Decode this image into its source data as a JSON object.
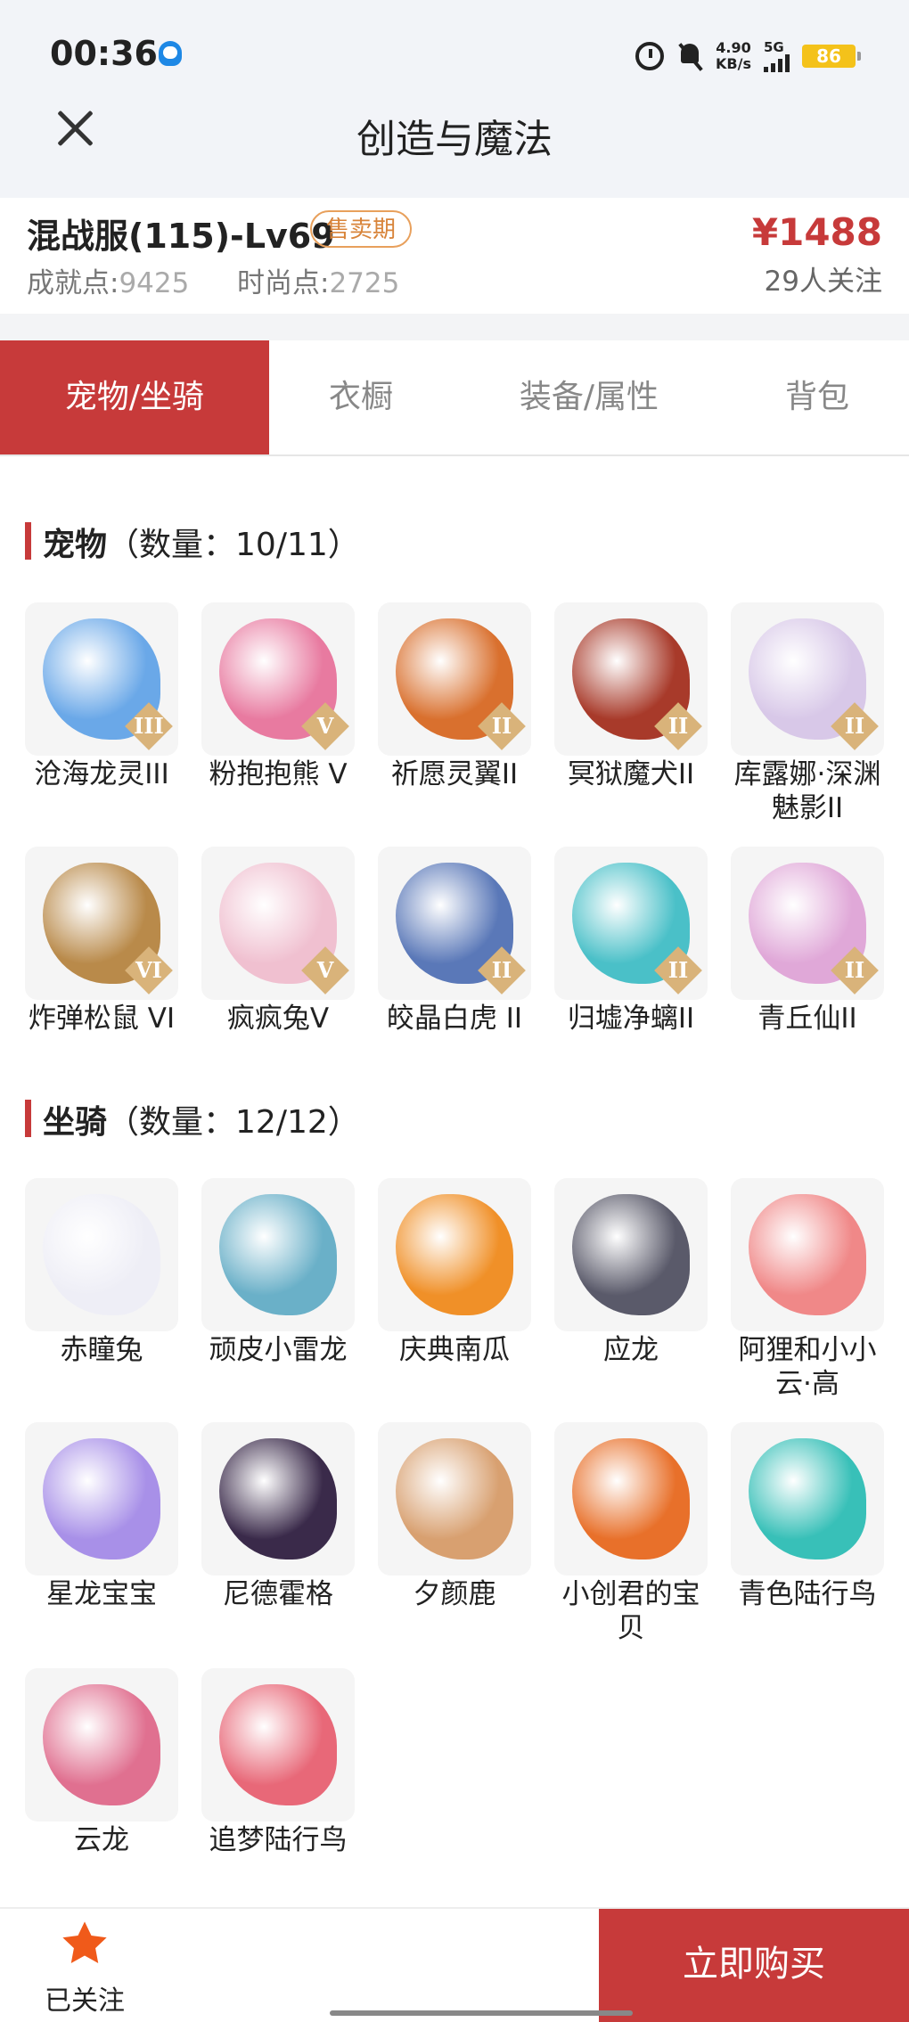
{
  "status_bar": {
    "time": "00:36",
    "net_speed_value": "4.90",
    "net_speed_unit": "KB/s",
    "network": "5G",
    "battery": "86",
    "icons": [
      "qq-icon",
      "alarm-icon",
      "mute-icon",
      "signal-icon",
      "battery-icon"
    ]
  },
  "header": {
    "title": "创造与魔法",
    "close_icon": "close-icon"
  },
  "account": {
    "name": "混战服(115)-Lv69",
    "badge": "售卖期",
    "achievement_label": "成就点:",
    "achievement_value": "9425",
    "fashion_label": "时尚点:",
    "fashion_value": "2725",
    "price": "¥1488",
    "followers": "29人关注"
  },
  "tabs": [
    "宠物/坐骑",
    "衣橱",
    "装备/属性",
    "背包"
  ],
  "active_tab": 0,
  "pets": {
    "title": "宠物",
    "count": "（数量：10/11）",
    "items": [
      {
        "name": "沧海龙灵III",
        "grade": "III",
        "color": "#6aa8e8"
      },
      {
        "name": "粉抱抱熊 V",
        "grade": "V",
        "color": "#e87aa0"
      },
      {
        "name": "祈愿灵翼II",
        "grade": "II",
        "color": "#d9702e"
      },
      {
        "name": "冥狱魔犬II",
        "grade": "II",
        "color": "#a83a2a"
      },
      {
        "name": "库露娜·深渊魅影II",
        "grade": "II",
        "color": "#d8c8e8"
      },
      {
        "name": "炸弹松鼠 VI",
        "grade": "VI",
        "color": "#b98a4a"
      },
      {
        "name": "疯疯兔V",
        "grade": "V",
        "color": "#f0c0d0"
      },
      {
        "name": "皎晶白虎 II",
        "grade": "II",
        "color": "#5a78b8"
      },
      {
        "name": "归墟净螭II",
        "grade": "II",
        "color": "#4ac0c8"
      },
      {
        "name": "青丘仙II",
        "grade": "II",
        "color": "#e0a8d8"
      }
    ]
  },
  "mounts": {
    "title": "坐骑",
    "count": "（数量：12/12）",
    "items": [
      {
        "name": "赤瞳兔",
        "color": "#eeeef6"
      },
      {
        "name": "顽皮小雷龙",
        "color": "#6ab0c8"
      },
      {
        "name": "庆典南瓜",
        "color": "#f09028"
      },
      {
        "name": "应龙",
        "color": "#5a5a6a"
      },
      {
        "name": "阿狸和小小云·高",
        "color": "#f08888"
      },
      {
        "name": "星龙宝宝",
        "color": "#a890e8"
      },
      {
        "name": "尼德霍格",
        "color": "#3a2a4a"
      },
      {
        "name": "夕颜鹿",
        "color": "#d8a070"
      },
      {
        "name": "小创君的宝贝",
        "color": "#e8702a"
      },
      {
        "name": "青色陆行鸟",
        "color": "#38c0b8"
      },
      {
        "name": "云龙",
        "color": "#e07090"
      },
      {
        "name": "追梦陆行鸟",
        "color": "#e86878"
      }
    ]
  },
  "bottom": {
    "follow_label": "已关注",
    "buy_label": "立即购买"
  }
}
